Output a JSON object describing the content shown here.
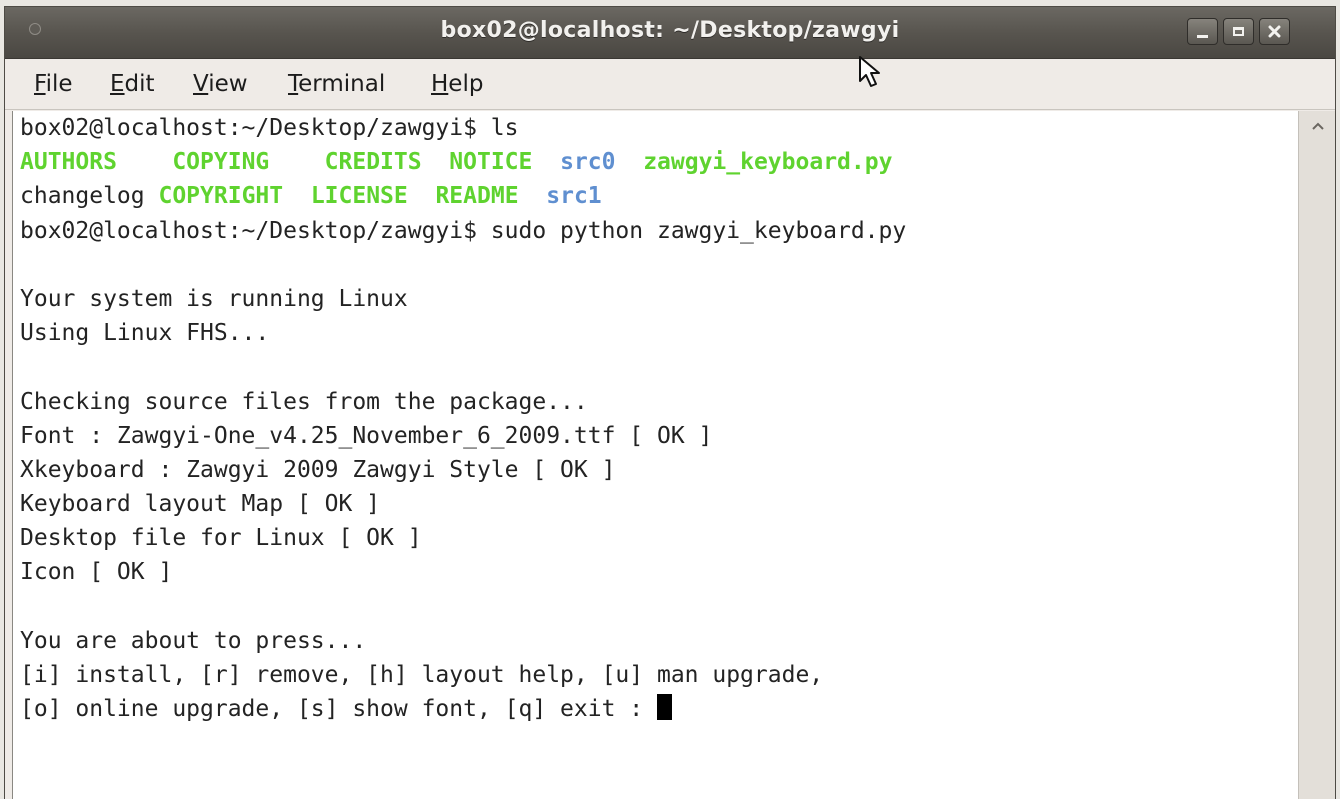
{
  "window": {
    "title": "box02@localhost: ~/Desktop/zawgyi",
    "controls": [
      "minimize",
      "maximize",
      "close"
    ]
  },
  "menu": [
    {
      "mnemonic": "F",
      "rest": "ile"
    },
    {
      "mnemonic": "E",
      "rest": "dit"
    },
    {
      "mnemonic": "V",
      "rest": "iew"
    },
    {
      "mnemonic": "T",
      "rest": "erminal"
    },
    {
      "mnemonic": "H",
      "rest": "elp"
    }
  ],
  "colors": {
    "text": "#232323",
    "file_green": "#5fd32f",
    "dir_blue": "#5f8fd0",
    "background": "#ffffff"
  },
  "terminal": {
    "lines": [
      [
        {
          "text": "box02@localhost:~/Desktop/zawgyi$ ls"
        }
      ],
      [
        {
          "text": "AUTHORS",
          "kind": "file"
        },
        {
          "text": "    "
        },
        {
          "text": "COPYING",
          "kind": "file"
        },
        {
          "text": "    "
        },
        {
          "text": "CREDITS",
          "kind": "file"
        },
        {
          "text": "  "
        },
        {
          "text": "NOTICE",
          "kind": "file"
        },
        {
          "text": "  "
        },
        {
          "text": "src0",
          "kind": "dir"
        },
        {
          "text": "  "
        },
        {
          "text": "zawgyi_keyboard.py",
          "kind": "file"
        }
      ],
      [
        {
          "text": "changelog"
        },
        {
          "text": " "
        },
        {
          "text": "COPYRIGHT",
          "kind": "file"
        },
        {
          "text": "  "
        },
        {
          "text": "LICENSE",
          "kind": "file"
        },
        {
          "text": "  "
        },
        {
          "text": "README",
          "kind": "file"
        },
        {
          "text": "  "
        },
        {
          "text": "src1",
          "kind": "dir"
        }
      ],
      [
        {
          "text": "box02@localhost:~/Desktop/zawgyi$ sudo python zawgyi_keyboard.py"
        }
      ],
      [
        {
          "text": ""
        }
      ],
      [
        {
          "text": "Your system is running Linux"
        }
      ],
      [
        {
          "text": "Using Linux FHS..."
        }
      ],
      [
        {
          "text": ""
        }
      ],
      [
        {
          "text": "Checking source files from the package..."
        }
      ],
      [
        {
          "text": "Font : Zawgyi-One_v4.25_November_6_2009.ttf [ OK ]"
        }
      ],
      [
        {
          "text": "Xkeyboard : Zawgyi 2009 Zawgyi Style [ OK ]"
        }
      ],
      [
        {
          "text": "Keyboard layout Map [ OK ]"
        }
      ],
      [
        {
          "text": "Desktop file for Linux [ OK ]"
        }
      ],
      [
        {
          "text": "Icon [ OK ]"
        }
      ],
      [
        {
          "text": ""
        }
      ],
      [
        {
          "text": "You are about to press..."
        }
      ],
      [
        {
          "text": "[i] install, [r] remove, [h] layout help, [u] man upgrade,"
        }
      ],
      [
        {
          "text": "[o] online upgrade, [s] show font, [q] exit : "
        },
        {
          "cursor": true
        }
      ]
    ]
  },
  "icons": {
    "window_dot": "circle-icon",
    "minimize": "minimize-icon",
    "maximize": "maximize-icon",
    "close": "close-icon",
    "scroll_up": "chevron-up-icon",
    "pointer": "mouse-pointer-icon"
  }
}
